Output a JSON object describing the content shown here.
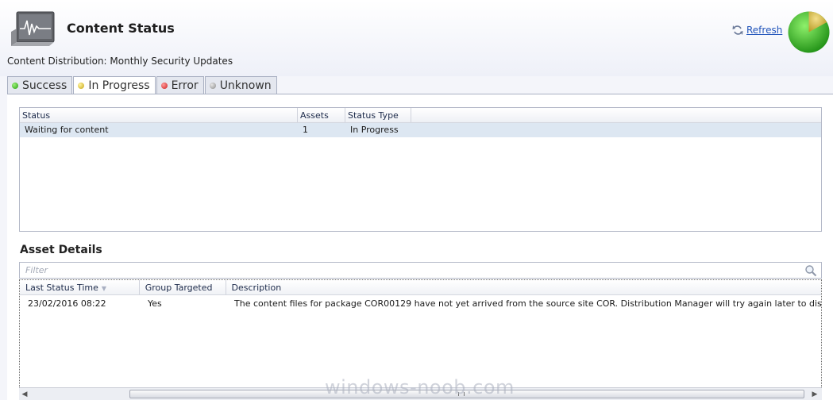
{
  "header": {
    "title": "Content Status",
    "subtitle": "Content Distribution: Monthly Security Updates",
    "refresh_label": "Refresh",
    "icon": "monitor-pulse-icon"
  },
  "tabs": [
    {
      "label": "Success",
      "status": "green",
      "active": false
    },
    {
      "label": "In Progress",
      "status": "yellow",
      "active": true
    },
    {
      "label": "Error",
      "status": "red",
      "active": false
    },
    {
      "label": "Unknown",
      "status": "gray",
      "active": false
    }
  ],
  "status_table": {
    "columns": [
      "Status",
      "Assets",
      "Status Type"
    ],
    "rows": [
      {
        "status": "Waiting for content",
        "assets": "1",
        "status_type": "In Progress"
      }
    ]
  },
  "asset_details": {
    "title": "Asset Details",
    "filter_placeholder": "Filter",
    "columns": [
      "Last Status Time",
      "Group Targeted",
      "Description"
    ],
    "rows": [
      {
        "time": "23/02/2016 08:22",
        "group_targeted": "Yes",
        "description": "The content files for package COR00129 have not yet arrived from the source site COR. Distribution Manager will try again later to distribute the content"
      }
    ]
  },
  "pie_status": {
    "success_fraction": 0.83,
    "in_progress_fraction": 0.17
  },
  "watermark": "windows-noob.com"
}
